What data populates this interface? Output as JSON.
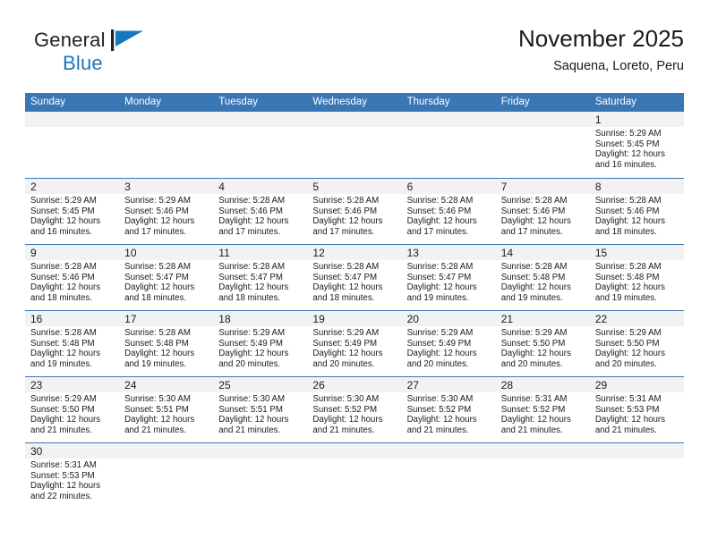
{
  "brand": {
    "name_part1": "General",
    "name_part2": "Blue",
    "flag_icon": "blue-flag-triangle",
    "accent_color": "#1878be"
  },
  "header": {
    "title": "November 2025",
    "subtitle": "Saquena, Loreto, Peru"
  },
  "theme": {
    "header_blue": "#3b76b4",
    "day_band_gray": "#f2f2f2",
    "text_color": "#1a1a1a"
  },
  "weekdays": [
    "Sunday",
    "Monday",
    "Tuesday",
    "Wednesday",
    "Thursday",
    "Friday",
    "Saturday"
  ],
  "weeks": [
    [
      {
        "day": "",
        "empty": true,
        "sunrise": "",
        "sunset": "",
        "daylight_line1": "",
        "daylight_line2": ""
      },
      {
        "day": "",
        "empty": true,
        "sunrise": "",
        "sunset": "",
        "daylight_line1": "",
        "daylight_line2": ""
      },
      {
        "day": "",
        "empty": true,
        "sunrise": "",
        "sunset": "",
        "daylight_line1": "",
        "daylight_line2": ""
      },
      {
        "day": "",
        "empty": true,
        "sunrise": "",
        "sunset": "",
        "daylight_line1": "",
        "daylight_line2": ""
      },
      {
        "day": "",
        "empty": true,
        "sunrise": "",
        "sunset": "",
        "daylight_line1": "",
        "daylight_line2": ""
      },
      {
        "day": "",
        "empty": true,
        "sunrise": "",
        "sunset": "",
        "daylight_line1": "",
        "daylight_line2": ""
      },
      {
        "day": "1",
        "empty": false,
        "sunrise": "Sunrise: 5:29 AM",
        "sunset": "Sunset: 5:45 PM",
        "daylight_line1": "Daylight: 12 hours",
        "daylight_line2": "and 16 minutes."
      }
    ],
    [
      {
        "day": "2",
        "empty": false,
        "sunrise": "Sunrise: 5:29 AM",
        "sunset": "Sunset: 5:45 PM",
        "daylight_line1": "Daylight: 12 hours",
        "daylight_line2": "and 16 minutes."
      },
      {
        "day": "3",
        "empty": false,
        "sunrise": "Sunrise: 5:29 AM",
        "sunset": "Sunset: 5:46 PM",
        "daylight_line1": "Daylight: 12 hours",
        "daylight_line2": "and 17 minutes."
      },
      {
        "day": "4",
        "empty": false,
        "sunrise": "Sunrise: 5:28 AM",
        "sunset": "Sunset: 5:46 PM",
        "daylight_line1": "Daylight: 12 hours",
        "daylight_line2": "and 17 minutes."
      },
      {
        "day": "5",
        "empty": false,
        "sunrise": "Sunrise: 5:28 AM",
        "sunset": "Sunset: 5:46 PM",
        "daylight_line1": "Daylight: 12 hours",
        "daylight_line2": "and 17 minutes."
      },
      {
        "day": "6",
        "empty": false,
        "sunrise": "Sunrise: 5:28 AM",
        "sunset": "Sunset: 5:46 PM",
        "daylight_line1": "Daylight: 12 hours",
        "daylight_line2": "and 17 minutes."
      },
      {
        "day": "7",
        "empty": false,
        "sunrise": "Sunrise: 5:28 AM",
        "sunset": "Sunset: 5:46 PM",
        "daylight_line1": "Daylight: 12 hours",
        "daylight_line2": "and 17 minutes."
      },
      {
        "day": "8",
        "empty": false,
        "sunrise": "Sunrise: 5:28 AM",
        "sunset": "Sunset: 5:46 PM",
        "daylight_line1": "Daylight: 12 hours",
        "daylight_line2": "and 18 minutes."
      }
    ],
    [
      {
        "day": "9",
        "empty": false,
        "sunrise": "Sunrise: 5:28 AM",
        "sunset": "Sunset: 5:46 PM",
        "daylight_line1": "Daylight: 12 hours",
        "daylight_line2": "and 18 minutes."
      },
      {
        "day": "10",
        "empty": false,
        "sunrise": "Sunrise: 5:28 AM",
        "sunset": "Sunset: 5:47 PM",
        "daylight_line1": "Daylight: 12 hours",
        "daylight_line2": "and 18 minutes."
      },
      {
        "day": "11",
        "empty": false,
        "sunrise": "Sunrise: 5:28 AM",
        "sunset": "Sunset: 5:47 PM",
        "daylight_line1": "Daylight: 12 hours",
        "daylight_line2": "and 18 minutes."
      },
      {
        "day": "12",
        "empty": false,
        "sunrise": "Sunrise: 5:28 AM",
        "sunset": "Sunset: 5:47 PM",
        "daylight_line1": "Daylight: 12 hours",
        "daylight_line2": "and 18 minutes."
      },
      {
        "day": "13",
        "empty": false,
        "sunrise": "Sunrise: 5:28 AM",
        "sunset": "Sunset: 5:47 PM",
        "daylight_line1": "Daylight: 12 hours",
        "daylight_line2": "and 19 minutes."
      },
      {
        "day": "14",
        "empty": false,
        "sunrise": "Sunrise: 5:28 AM",
        "sunset": "Sunset: 5:48 PM",
        "daylight_line1": "Daylight: 12 hours",
        "daylight_line2": "and 19 minutes."
      },
      {
        "day": "15",
        "empty": false,
        "sunrise": "Sunrise: 5:28 AM",
        "sunset": "Sunset: 5:48 PM",
        "daylight_line1": "Daylight: 12 hours",
        "daylight_line2": "and 19 minutes."
      }
    ],
    [
      {
        "day": "16",
        "empty": false,
        "sunrise": "Sunrise: 5:28 AM",
        "sunset": "Sunset: 5:48 PM",
        "daylight_line1": "Daylight: 12 hours",
        "daylight_line2": "and 19 minutes."
      },
      {
        "day": "17",
        "empty": false,
        "sunrise": "Sunrise: 5:28 AM",
        "sunset": "Sunset: 5:48 PM",
        "daylight_line1": "Daylight: 12 hours",
        "daylight_line2": "and 19 minutes."
      },
      {
        "day": "18",
        "empty": false,
        "sunrise": "Sunrise: 5:29 AM",
        "sunset": "Sunset: 5:49 PM",
        "daylight_line1": "Daylight: 12 hours",
        "daylight_line2": "and 20 minutes."
      },
      {
        "day": "19",
        "empty": false,
        "sunrise": "Sunrise: 5:29 AM",
        "sunset": "Sunset: 5:49 PM",
        "daylight_line1": "Daylight: 12 hours",
        "daylight_line2": "and 20 minutes."
      },
      {
        "day": "20",
        "empty": false,
        "sunrise": "Sunrise: 5:29 AM",
        "sunset": "Sunset: 5:49 PM",
        "daylight_line1": "Daylight: 12 hours",
        "daylight_line2": "and 20 minutes."
      },
      {
        "day": "21",
        "empty": false,
        "sunrise": "Sunrise: 5:29 AM",
        "sunset": "Sunset: 5:50 PM",
        "daylight_line1": "Daylight: 12 hours",
        "daylight_line2": "and 20 minutes."
      },
      {
        "day": "22",
        "empty": false,
        "sunrise": "Sunrise: 5:29 AM",
        "sunset": "Sunset: 5:50 PM",
        "daylight_line1": "Daylight: 12 hours",
        "daylight_line2": "and 20 minutes."
      }
    ],
    [
      {
        "day": "23",
        "empty": false,
        "sunrise": "Sunrise: 5:29 AM",
        "sunset": "Sunset: 5:50 PM",
        "daylight_line1": "Daylight: 12 hours",
        "daylight_line2": "and 21 minutes."
      },
      {
        "day": "24",
        "empty": false,
        "sunrise": "Sunrise: 5:30 AM",
        "sunset": "Sunset: 5:51 PM",
        "daylight_line1": "Daylight: 12 hours",
        "daylight_line2": "and 21 minutes."
      },
      {
        "day": "25",
        "empty": false,
        "sunrise": "Sunrise: 5:30 AM",
        "sunset": "Sunset: 5:51 PM",
        "daylight_line1": "Daylight: 12 hours",
        "daylight_line2": "and 21 minutes."
      },
      {
        "day": "26",
        "empty": false,
        "sunrise": "Sunrise: 5:30 AM",
        "sunset": "Sunset: 5:52 PM",
        "daylight_line1": "Daylight: 12 hours",
        "daylight_line2": "and 21 minutes."
      },
      {
        "day": "27",
        "empty": false,
        "sunrise": "Sunrise: 5:30 AM",
        "sunset": "Sunset: 5:52 PM",
        "daylight_line1": "Daylight: 12 hours",
        "daylight_line2": "and 21 minutes."
      },
      {
        "day": "28",
        "empty": false,
        "sunrise": "Sunrise: 5:31 AM",
        "sunset": "Sunset: 5:52 PM",
        "daylight_line1": "Daylight: 12 hours",
        "daylight_line2": "and 21 minutes."
      },
      {
        "day": "29",
        "empty": false,
        "sunrise": "Sunrise: 5:31 AM",
        "sunset": "Sunset: 5:53 PM",
        "daylight_line1": "Daylight: 12 hours",
        "daylight_line2": "and 21 minutes."
      }
    ],
    [
      {
        "day": "30",
        "empty": false,
        "sunrise": "Sunrise: 5:31 AM",
        "sunset": "Sunset: 5:53 PM",
        "daylight_line1": "Daylight: 12 hours",
        "daylight_line2": "and 22 minutes."
      },
      {
        "day": "",
        "empty": true,
        "sunrise": "",
        "sunset": "",
        "daylight_line1": "",
        "daylight_line2": ""
      },
      {
        "day": "",
        "empty": true,
        "sunrise": "",
        "sunset": "",
        "daylight_line1": "",
        "daylight_line2": ""
      },
      {
        "day": "",
        "empty": true,
        "sunrise": "",
        "sunset": "",
        "daylight_line1": "",
        "daylight_line2": ""
      },
      {
        "day": "",
        "empty": true,
        "sunrise": "",
        "sunset": "",
        "daylight_line1": "",
        "daylight_line2": ""
      },
      {
        "day": "",
        "empty": true,
        "sunrise": "",
        "sunset": "",
        "daylight_line1": "",
        "daylight_line2": ""
      },
      {
        "day": "",
        "empty": true,
        "sunrise": "",
        "sunset": "",
        "daylight_line1": "",
        "daylight_line2": ""
      }
    ]
  ]
}
